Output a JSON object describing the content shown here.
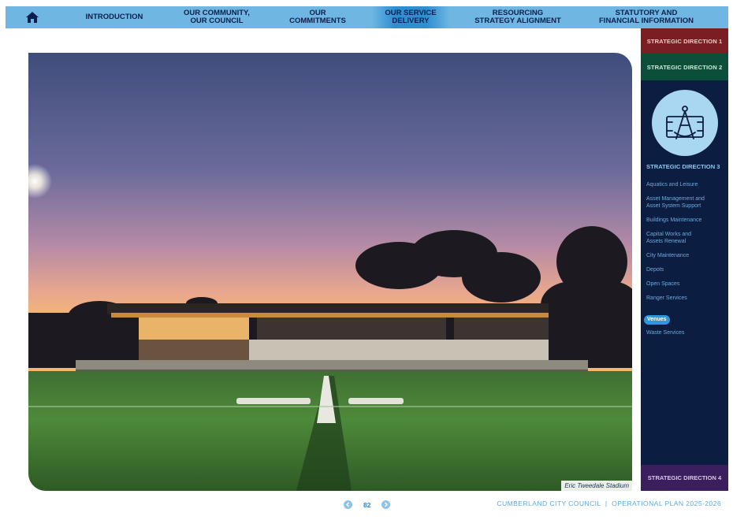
{
  "nav": {
    "home_icon": "home-icon",
    "items": [
      {
        "label": "INTRODUCTION"
      },
      {
        "label": "OUR COMMUNITY,\nOUR COUNCIL"
      },
      {
        "label": "OUR\nCOMMITMENTS"
      },
      {
        "label": "OUR SERVICE\nDELIVERY"
      },
      {
        "label": "RESOURCING\nSTRATEGY ALIGNMENT"
      },
      {
        "label": "STATUTORY AND\nFINANCIAL INFORMATION"
      }
    ],
    "active_index": 3
  },
  "photo": {
    "caption": "Eric Tweedale Stadium"
  },
  "sidebar": {
    "direction1": "STRATEGIC DIRECTION 1",
    "direction2": "STRATEGIC DIRECTION 2",
    "direction3": "STRATEGIC DIRECTION 3",
    "direction3_icon": "drafting-compass-icon",
    "services": [
      "Aquatics and Leisure",
      "Asset Management and\nAsset System Support",
      "Buildings Maintenance",
      "Capital Works and\nAssets Renewal",
      "City Maintenance",
      "Depots",
      "Open Spaces",
      "Ranger Services",
      "Venues",
      "Waste Services"
    ],
    "active_service": "Venues",
    "direction4": "STRATEGIC DIRECTION 4"
  },
  "footer": {
    "page_number": "82",
    "prev_icon": "chevron-left-icon",
    "next_icon": "chevron-right-icon",
    "title": "CUMBERLAND CITY COUNCIL  |  OPERATIONAL PLAN 2025-2026"
  },
  "colors": {
    "nav_bg": "#6fb6e3",
    "direction1": "#7a1e22",
    "direction2": "#0b4f3a",
    "direction3": "#0c1d42",
    "direction4": "#3b1e5d",
    "accent": "#2f95dc"
  }
}
